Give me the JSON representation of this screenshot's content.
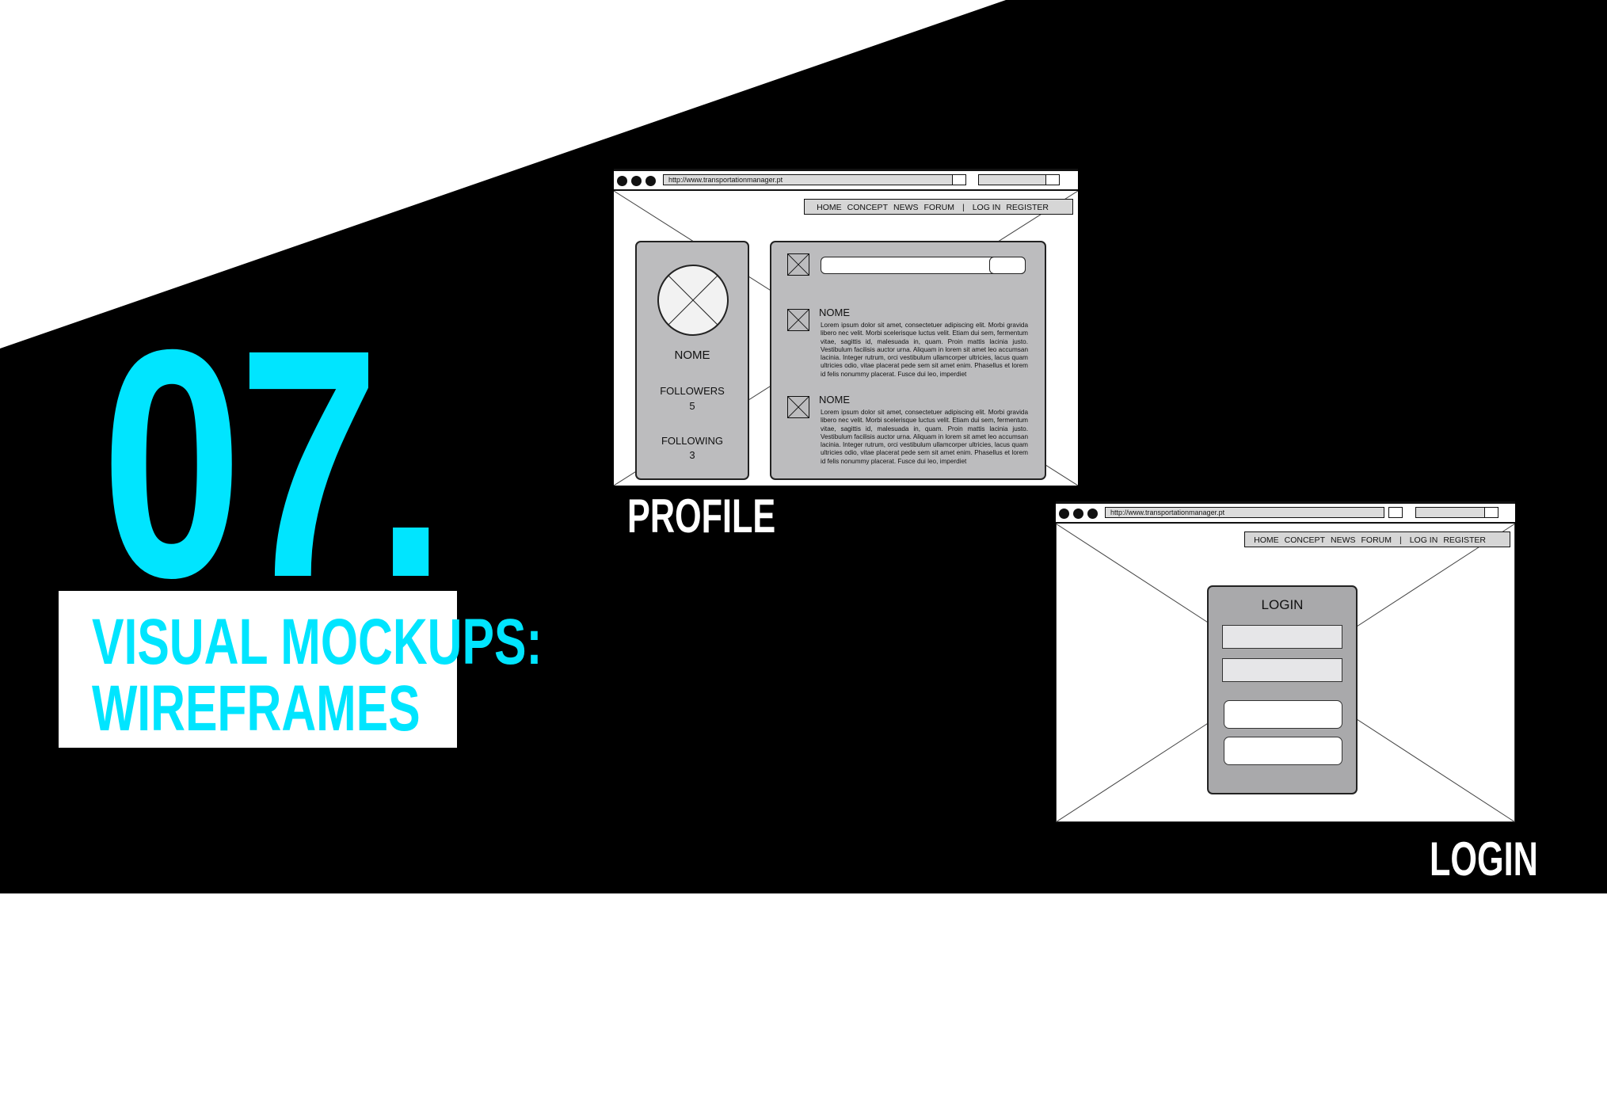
{
  "section": {
    "number": "07.",
    "title_line1": "VISUAL MOCKUPS:",
    "title_line2": "WIREFRAMES"
  },
  "colors": {
    "accent": "#00e5ff",
    "dark": "#000000",
    "panel": "#bcbcbe"
  },
  "profile": {
    "caption": "PROFILE",
    "url": "http://www.transportationmanager.pt",
    "nav": [
      "HOME",
      "CONCEPT",
      "NEWS",
      "FORUM",
      "|",
      "LOG IN",
      "REGISTER"
    ],
    "name": "NOME",
    "followers_label": "FOLLOWERS",
    "followers_count": "5",
    "following_label": "FOLLOWING",
    "following_count": "3",
    "posts": [
      {
        "name": "NOME",
        "text": "Lorem ipsum dolor sit amet, consectetuer adipiscing elit. Morbi gravida libero nec velit. Morbi scelerisque luctus velit. Etiam dui sem, fermentum vitae, sagittis id, malesuada in, quam. Proin mattis lacinia justo. Vestibulum facilisis auctor urna. Aliquam in lorem sit amet leo accumsan lacinia. Integer rutrum, orci vestibulum ullamcorper ultricies, lacus quam ultricies odio, vitae placerat pede sem sit amet enim. Phasellus et lorem id felis nonummy placerat. Fusce dui leo, imperdiet"
      },
      {
        "name": "NOME",
        "text": "Lorem ipsum dolor sit amet, consectetuer adipiscing elit. Morbi gravida libero nec velit. Morbi scelerisque luctus velit. Etiam dui sem, fermentum vitae, sagittis id, malesuada in, quam. Proin mattis lacinia justo. Vestibulum facilisis auctor urna. Aliquam in lorem sit amet leo accumsan lacinia. Integer rutrum, orci vestibulum ullamcorper ultricies, lacus quam ultricies odio, vitae placerat pede sem sit amet enim. Phasellus et lorem id felis nonummy placerat. Fusce dui leo, imperdiet"
      }
    ]
  },
  "login": {
    "caption": "LOGIN",
    "url": "http://www.transportationmanager.pt",
    "nav": [
      "HOME",
      "CONCEPT",
      "NEWS",
      "FORUM",
      "|",
      "LOG IN",
      "REGISTER"
    ],
    "form_title": "LOGIN"
  }
}
